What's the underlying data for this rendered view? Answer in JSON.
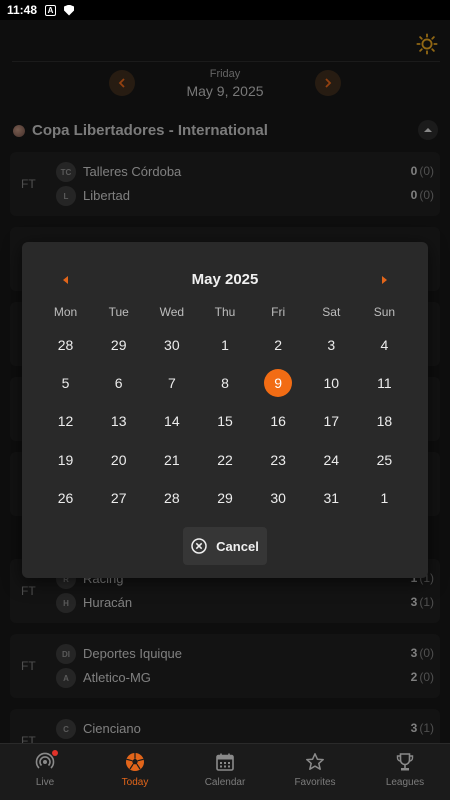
{
  "status_bar": {
    "time": "11:48",
    "icon_a": "A"
  },
  "header": {
    "weekday": "Friday",
    "date": "May 9, 2025",
    "theme_icon": "sun-icon",
    "accent_color": "#e2651a"
  },
  "leagues": [
    {
      "name": "Copa Libertadores - International"
    }
  ],
  "matches": [
    {
      "status": "FT",
      "home": {
        "abbr": "TC",
        "name": "Talleres Córdoba",
        "score": "0",
        "pen": "(0)"
      },
      "away": {
        "abbr": "L",
        "name": "Libertad",
        "score": "0",
        "pen": "(0)"
      }
    },
    {
      "status": "FT",
      "home": {
        "abbr": "R",
        "name": "Racing",
        "score": "1",
        "pen": "(1)"
      },
      "away": {
        "abbr": "H",
        "name": "Huracán",
        "score": "3",
        "pen": "(1)"
      }
    },
    {
      "status": "FT",
      "home": {
        "abbr": "DI",
        "name": "Deportes Iquique",
        "score": "3",
        "pen": "(0)"
      },
      "away": {
        "abbr": "A",
        "name": "Atletico-MG",
        "score": "2",
        "pen": "(0)"
      }
    },
    {
      "status": "FT",
      "home": {
        "abbr": "C",
        "name": "Cienciano",
        "score": "3",
        "pen": "(1)"
      },
      "away": {
        "abbr": "",
        "name": "",
        "score": "",
        "pen": ""
      }
    }
  ],
  "date_picker": {
    "title": "May 2025",
    "weekdays": [
      "Mon",
      "Tue",
      "Wed",
      "Thu",
      "Fri",
      "Sat",
      "Sun"
    ],
    "days": [
      "28",
      "29",
      "30",
      "1",
      "2",
      "3",
      "4",
      "5",
      "6",
      "7",
      "8",
      "9",
      "10",
      "11",
      "12",
      "13",
      "14",
      "15",
      "16",
      "17",
      "18",
      "19",
      "20",
      "21",
      "22",
      "23",
      "24",
      "25",
      "26",
      "27",
      "28",
      "29",
      "30",
      "31",
      "1"
    ],
    "selected_day": "9",
    "cancel_label": "Cancel",
    "selected_color": "#f26c14"
  },
  "bottom_nav": [
    {
      "label": "Live",
      "icon": "live-icon",
      "active": false
    },
    {
      "label": "Today",
      "icon": "soccer-ball-icon",
      "active": true
    },
    {
      "label": "Calendar",
      "icon": "calendar-icon",
      "active": false
    },
    {
      "label": "Favorites",
      "icon": "star-icon",
      "active": false
    },
    {
      "label": "Leagues",
      "icon": "trophy-icon",
      "active": false
    }
  ]
}
